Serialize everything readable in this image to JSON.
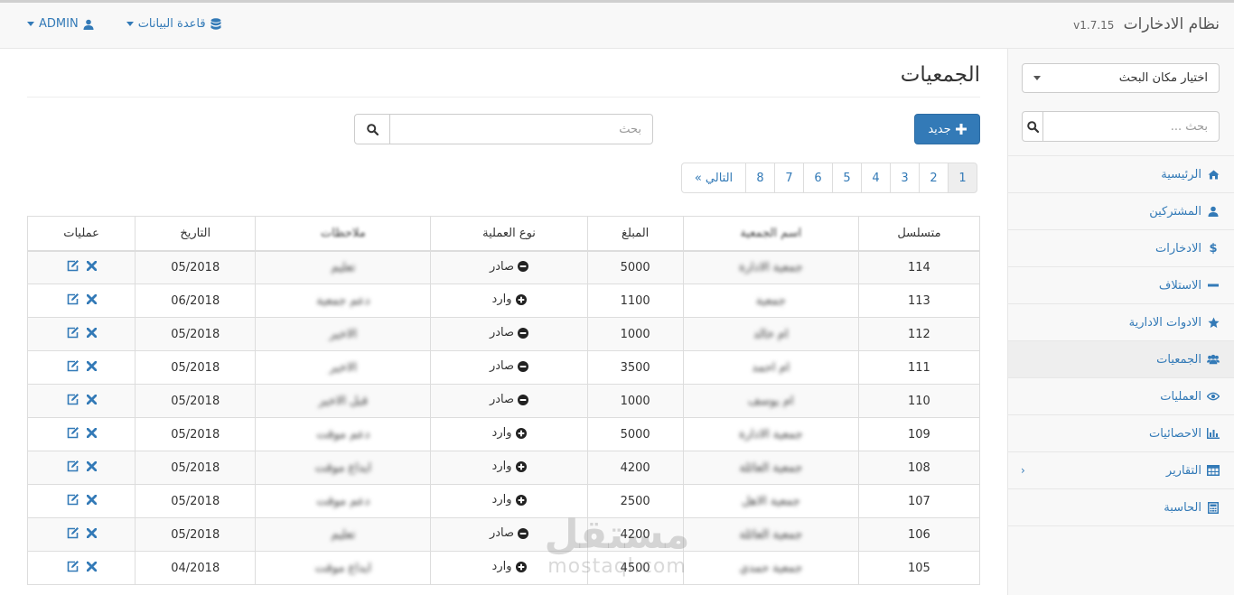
{
  "app": {
    "title": "نظام الادخارات",
    "version": "v1.7.15"
  },
  "topnav": {
    "database_label": "قاعدة البيانات",
    "user_label": "ADMIN"
  },
  "sidebar": {
    "place_select": "اختيار مكان البحث",
    "search_placeholder": "بحث ...",
    "items": [
      {
        "label": "الرئيسية",
        "icon": "home-icon"
      },
      {
        "label": "المشتركين",
        "icon": "user-icon"
      },
      {
        "label": "الادخارات",
        "icon": "dollar-icon"
      },
      {
        "label": "الاستلاف",
        "icon": "minus-icon"
      },
      {
        "label": "الادوات الادارية",
        "icon": "star-icon"
      },
      {
        "label": "الجمعيات",
        "icon": "users-icon"
      },
      {
        "label": "العمليات",
        "icon": "eye-icon"
      },
      {
        "label": "الاحصائيات",
        "icon": "bar-chart-icon"
      },
      {
        "label": "التقارير",
        "icon": "table-icon"
      },
      {
        "label": "الحاسبة",
        "icon": "calculator-icon"
      }
    ]
  },
  "main": {
    "title": "الجمعيات",
    "new_button": "جديد",
    "search_placeholder": "بحث",
    "pagination": {
      "pages": [
        "1",
        "2",
        "3",
        "4",
        "5",
        "6",
        "7",
        "8"
      ],
      "next": "التالي »",
      "current": "1"
    },
    "table": {
      "headers": {
        "serial": "متسلسل",
        "name": "اسم الجمعية",
        "amount": "المبلغ",
        "type": "نوع العملية",
        "notes": "ملاحظات",
        "date": "التاريخ",
        "ops": "عمليات"
      },
      "rows": [
        {
          "serial": "114",
          "name": "جمعية الادارة",
          "amount": "5000",
          "type": "صادر",
          "notes": "تعليم",
          "date": "05/2018"
        },
        {
          "serial": "113",
          "name": "جمعية",
          "amount": "1100",
          "type": "وارد",
          "notes": "دعم جمعية",
          "date": "06/2018"
        },
        {
          "serial": "112",
          "name": "ام خالد",
          "amount": "1000",
          "type": "صادر",
          "notes": "الاخير",
          "date": "05/2018"
        },
        {
          "serial": "111",
          "name": "ام احمد",
          "amount": "3500",
          "type": "صادر",
          "notes": "الاخير",
          "date": "05/2018"
        },
        {
          "serial": "110",
          "name": "ام يوسف",
          "amount": "1000",
          "type": "صادر",
          "notes": "قبل الاخير",
          "date": "05/2018"
        },
        {
          "serial": "109",
          "name": "جمعية الادارة",
          "amount": "5000",
          "type": "وارد",
          "notes": "دعم موقت",
          "date": "05/2018"
        },
        {
          "serial": "108",
          "name": "جمعية العائلة",
          "amount": "4200",
          "type": "وارد",
          "notes": "ايداع موقت",
          "date": "05/2018"
        },
        {
          "serial": "107",
          "name": "جمعية الاهل",
          "amount": "2500",
          "type": "وارد",
          "notes": "دعم موقت",
          "date": "05/2018"
        },
        {
          "serial": "106",
          "name": "جمعية العائلة",
          "amount": "4200",
          "type": "صادر",
          "notes": "تعليم",
          "date": "05/2018"
        },
        {
          "serial": "105",
          "name": "جمعية حمدي",
          "amount": "4500",
          "type": "وارد",
          "notes": "ايداع موقت",
          "date": "04/2018"
        }
      ]
    }
  },
  "watermark": {
    "arabic": "مستقل",
    "latin": "mostaql.com"
  },
  "colors": {
    "link": "#337ab7",
    "primary": "#337ab7",
    "nav_bg": "#f8f8f8"
  }
}
